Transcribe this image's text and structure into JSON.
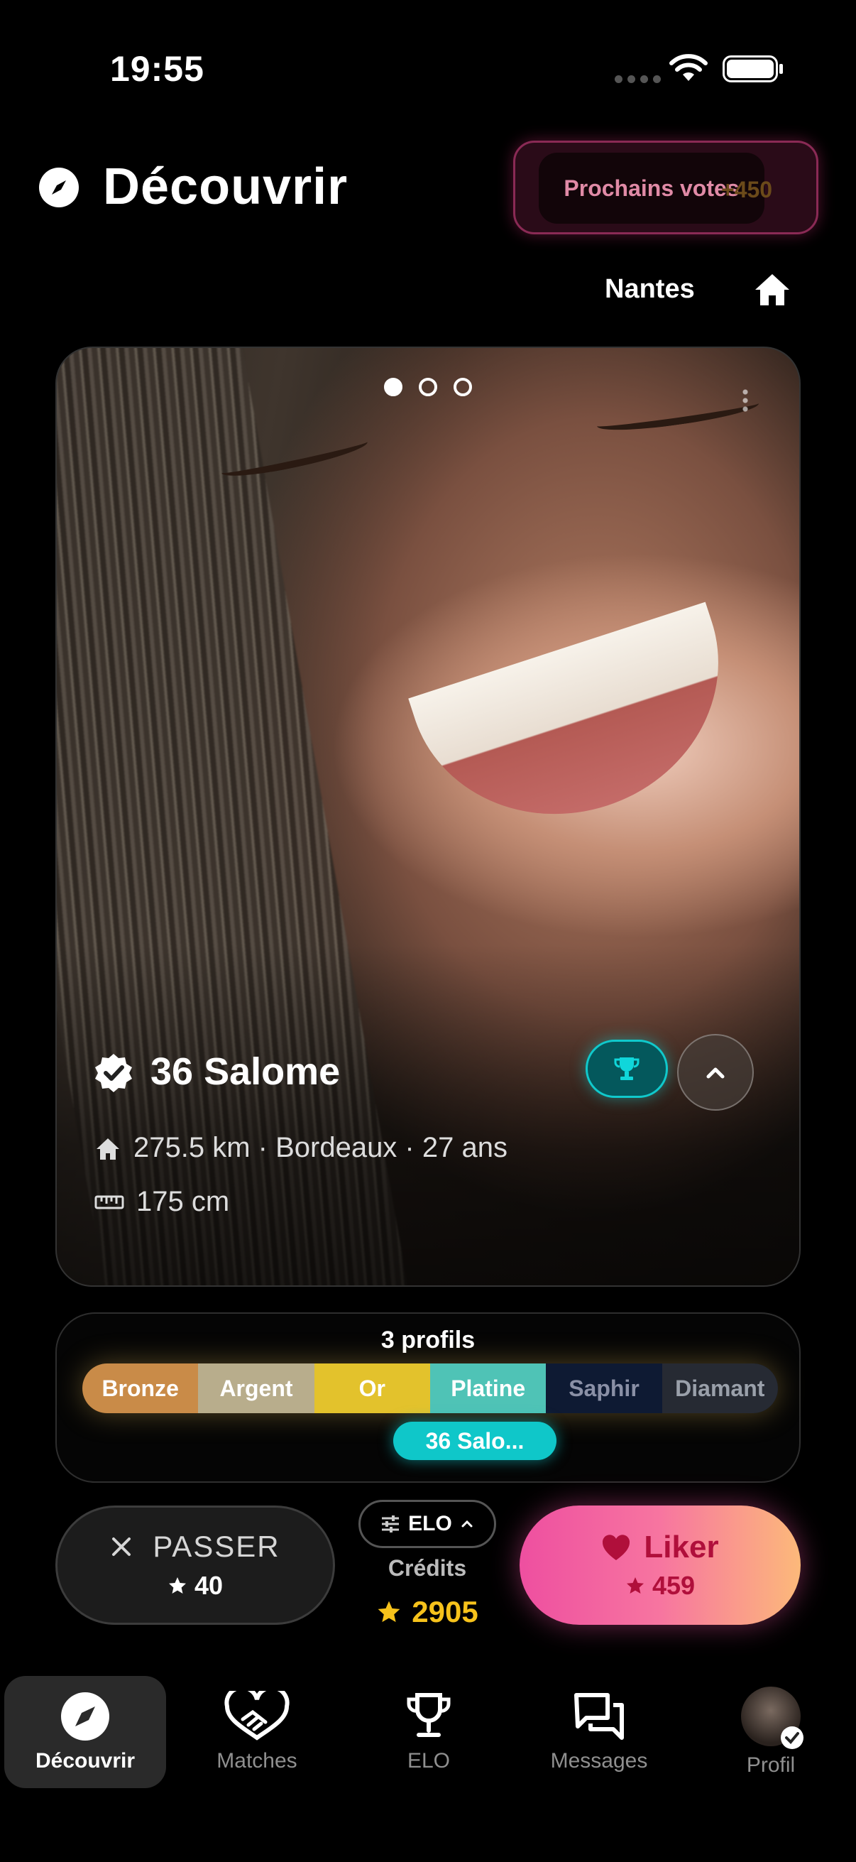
{
  "status_bar": {
    "time": "19:55"
  },
  "header": {
    "title": "Découvrir",
    "votes_button": "Prochains votes",
    "votes_ghost": "+450",
    "city": "Nantes"
  },
  "card": {
    "name": "36 Salome",
    "meta_location": "275.5 km · Bordeaux  · 27 ans",
    "meta_height": "175 cm",
    "photo_count": 3,
    "photo_index": 1
  },
  "rank": {
    "count_label": "3 profils",
    "tiers": [
      {
        "label": "Bronze",
        "color": "#c98b48"
      },
      {
        "label": "Argent",
        "color": "#b8ad8c"
      },
      {
        "label": "Or",
        "color": "#e3c22c"
      },
      {
        "label": "Platine",
        "color": "#4fc3b6"
      },
      {
        "label": "Saphir",
        "color": "#0e1a33"
      },
      {
        "label": "Diamant",
        "color": "#262a33"
      }
    ],
    "current": "36 Salo..."
  },
  "actions": {
    "pass_label": "PASSER",
    "pass_cost": "40",
    "elo_chip": "ELO",
    "credits_label": "Crédits",
    "credits_value": "2905",
    "like_label": "Liker",
    "like_cost": "459"
  },
  "tabs": [
    {
      "label": "Découvrir"
    },
    {
      "label": "Matches"
    },
    {
      "label": "ELO"
    },
    {
      "label": "Messages"
    },
    {
      "label": "Profil"
    }
  ],
  "colors": {
    "accent_cyan": "#0fc7c9",
    "like_pink": "#ee4fa0",
    "like_orange": "#fcb97a",
    "credits_gold": "#f6c21b"
  }
}
